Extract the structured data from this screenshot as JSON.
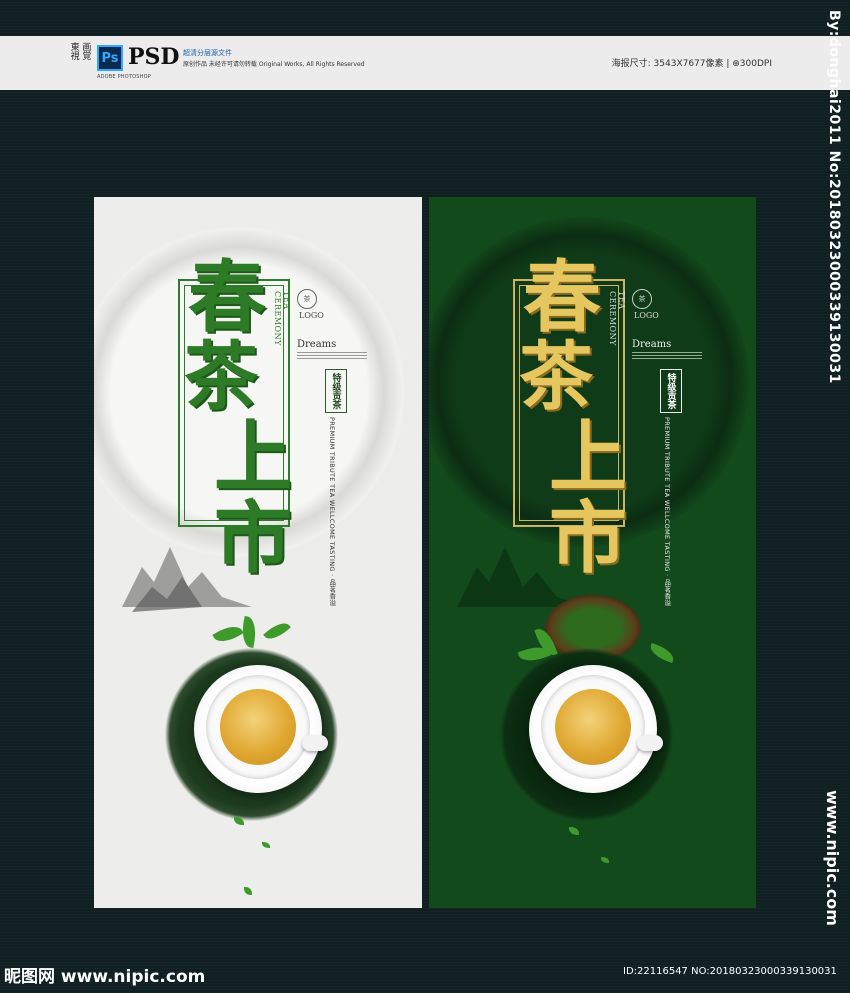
{
  "banner": {
    "brand": "東 画 視 覚",
    "ps_icon": "Ps",
    "ps_sub": "ADOBE PHOTOSHOP",
    "psd": "PSD",
    "line1": "超清分层源文件",
    "line2": "原创作品 未经许可请勿转载 Original Works, All Rights Reserved",
    "spec": "海报尺寸: 3543X7677像素 | ⊕300DPI"
  },
  "watermarks": {
    "side_top": "By:donghai2011 No:20180323000339130031",
    "side_bottom": "www.nipic.com",
    "bottom_left": "昵图网 www.nipic.com",
    "bottom_right": "ID:22116547 NO:20180323000339130031"
  },
  "poster": {
    "calligraphy": [
      "春",
      "茶",
      "上市"
    ],
    "tea_ceremony": "TEA CEREMONY",
    "seal_text": "茶",
    "logo": "LOGO",
    "dreams": "Dreams",
    "grade": "特级贡茶",
    "premium": "PREMIUM TRIBUTE TEA WELLCOME TASTING · 品茗香溢"
  },
  "colors": {
    "light_bg": "#ededeb",
    "dark_bg": "#124a1c",
    "green_accent": "#2d7a27",
    "gold_accent": "#e6c75f"
  }
}
